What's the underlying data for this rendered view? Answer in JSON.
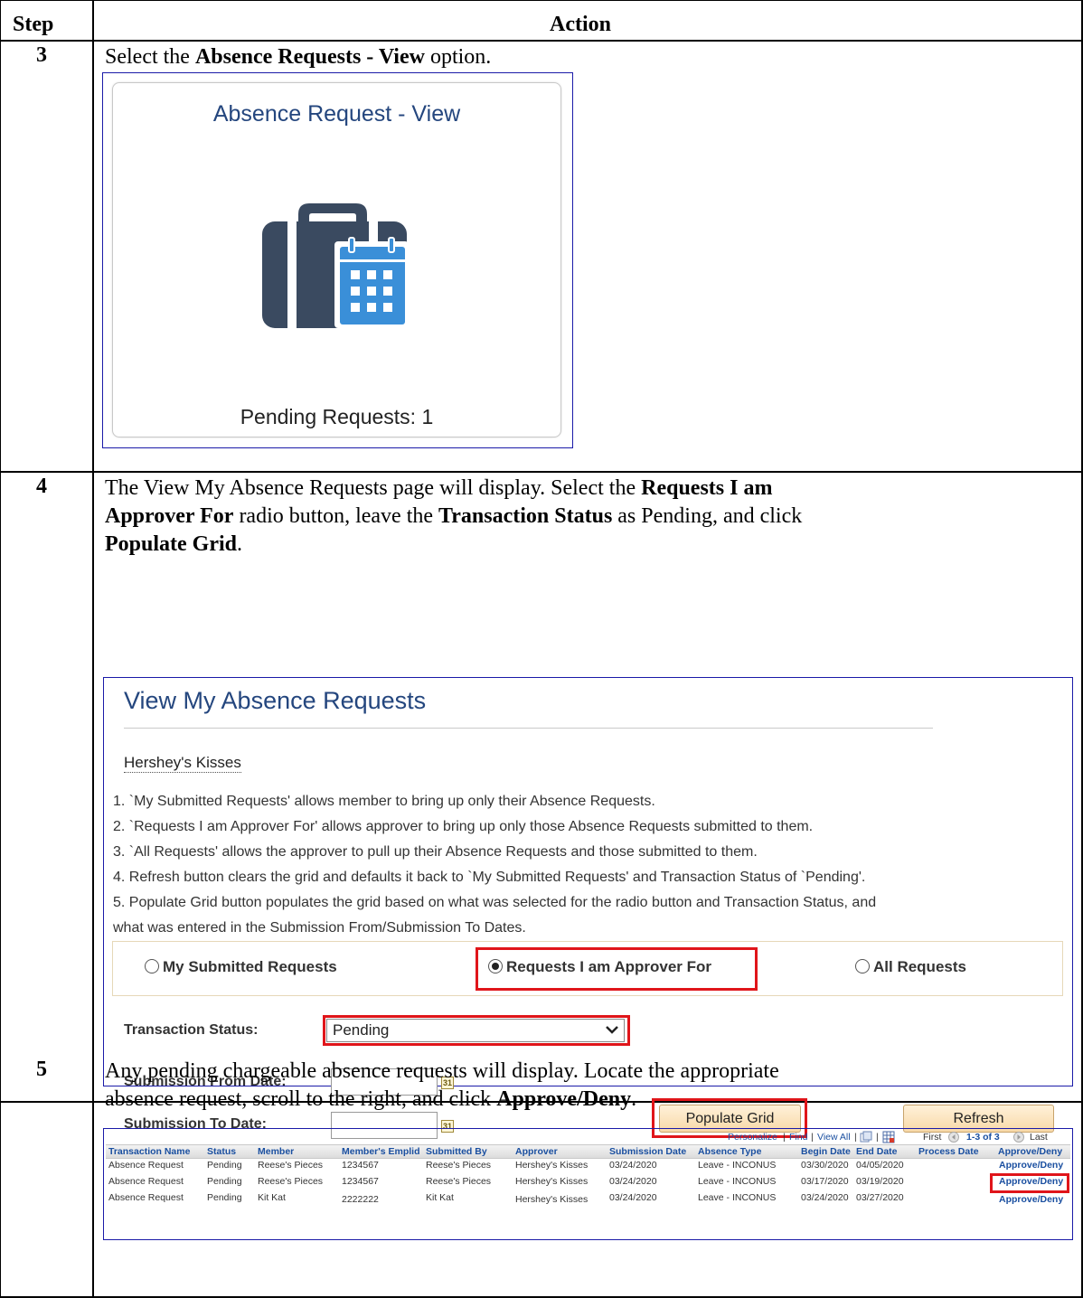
{
  "table": {
    "header_step": "Step",
    "header_action": "Action"
  },
  "step3": {
    "number": "3",
    "text_pre": "Select the ",
    "text_bold": "Absence Requests - View",
    "text_post": " option.",
    "tile": {
      "title": "Absence Request - View",
      "pending": "Pending Requests: 1",
      "icon": "briefcase-calendar-icon",
      "icon_color": "#3a4a60",
      "calendar_color": "#3a8fd8"
    }
  },
  "step4": {
    "number": "4",
    "line1_pre": "The View My Absence Requests page will display.  Select the ",
    "line1_bold": "Requests I am",
    "line2_bold": "Approver For",
    "line2_mid": " radio button, leave the ",
    "line2_bold2": "Transaction Status",
    "line2_post": " as Pending, and click",
    "line3_bold": "Populate Grid",
    "line3_post": ".",
    "panel": {
      "title": "View My Absence Requests",
      "user_name": "Hershey's Kisses",
      "instructions": [
        "1. `My Submitted Requests' allows member to bring up only their Absence Requests.",
        "2. `Requests I am Approver For' allows approver to bring up only those Absence Requests submitted to them.",
        "3. `All Requests' allows the approver to pull up their Absence Requests and those submitted to them.",
        "4. Refresh button clears the grid and defaults it back to `My Submitted Requests' and Transaction Status of `Pending'.",
        "5. Populate Grid button populates the grid based on what was selected for the radio button and Transaction Status, and",
        "what was entered in the Submission From/Submission To Dates."
      ],
      "radio_my": "My Submitted Requests",
      "radio_approver": "Requests I am Approver For",
      "radio_all": "All Requests",
      "transaction_status_label": "Transaction Status:",
      "transaction_status_value": "Pending",
      "from_date_label": "Submission From Date:",
      "to_date_label": "Submission To Date:",
      "calendar_glyph": "31",
      "populate_button": "Populate Grid",
      "refresh_button": "Refresh",
      "highlight_color": "#e0151a"
    }
  },
  "step5": {
    "number": "5",
    "line1": "Any pending chargeable absence requests will display.  Locate the appropriate",
    "line2_pre": "absence request, scroll to the right, and click ",
    "line2_bold": "Approve/Deny",
    "line2_post": ".",
    "grid": {
      "personalize": "Personalize",
      "find": "Find",
      "view_all": "View All",
      "sep": "|",
      "first": "First",
      "range": "1-3 of 3",
      "last": "Last",
      "columns": [
        "Transaction Name",
        "Status",
        "Member",
        "Member's Emplid",
        "Submitted By",
        "Approver",
        "Submission Date",
        "Absence Type",
        "Begin Date",
        "End Date",
        "Process Date",
        "Approve/Deny"
      ],
      "rows": [
        [
          "Absence Request",
          "Pending",
          "Reese's Pieces",
          "1234567",
          "Reese's Pieces",
          "Hershey's Kisses",
          "03/24/2020",
          "Leave - INCONUS",
          "03/30/2020",
          "04/05/2020",
          "",
          "Approve/Deny"
        ],
        [
          "Absence Request",
          "Pending",
          "Reese's Pieces",
          "1234567",
          "Reese's Pieces",
          "Hershey's Kisses",
          "03/24/2020",
          "Leave - INCONUS",
          "03/17/2020",
          "03/19/2020",
          "",
          "Approve/Deny"
        ],
        [
          "Absence Request",
          "Pending",
          "Kit Kat",
          "2222222",
          "Kit Kat",
          "Hershey's Kisses",
          "03/24/2020",
          "Leave - INCONUS",
          "03/24/2020",
          "03/27/2020",
          "",
          "Approve/Deny"
        ]
      ]
    }
  }
}
